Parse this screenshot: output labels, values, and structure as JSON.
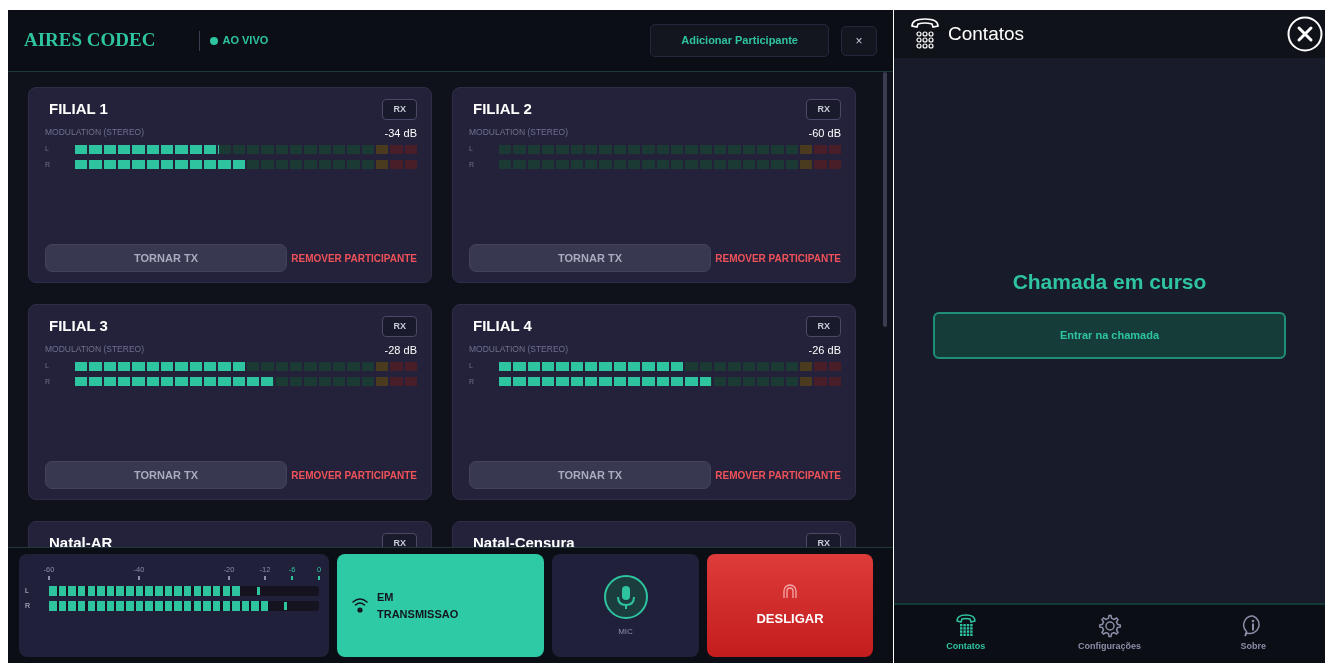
{
  "app": {
    "title": "AIRES CODEC",
    "status": {
      "label": "AO VIVO",
      "live": true
    },
    "add_button": "Adicionar Participante",
    "close_button": "×"
  },
  "participants": [
    {
      "name": "FILIAL 1",
      "badge": "RX",
      "meter_label": "MODULATION (STEREO)",
      "reading": "-34 dB",
      "channels": [
        {
          "label": "L",
          "level": 0.42
        },
        {
          "label": "R",
          "level": 0.5
        }
      ],
      "tx_button": "TORNAR TX",
      "remove_link": "REMOVER PARTICIPANTE"
    },
    {
      "name": "FILIAL 2",
      "badge": "RX",
      "meter_label": "MODULATION (STEREO)",
      "reading": "-60 dB",
      "channels": [
        {
          "label": "L",
          "level": 0
        },
        {
          "label": "R",
          "level": 0
        }
      ],
      "tx_button": "TORNAR TX",
      "remove_link": "REMOVER PARTICIPANTE"
    },
    {
      "name": "FILIAL 3",
      "badge": "RX",
      "meter_label": "MODULATION (STEREO)",
      "reading": "-28 dB",
      "channels": [
        {
          "label": "L",
          "level": 0.5
        },
        {
          "label": "R",
          "level": 0.58
        }
      ],
      "tx_button": "TORNAR TX",
      "remove_link": "REMOVER PARTICIPANTE"
    },
    {
      "name": "FILIAL 4",
      "badge": "RX",
      "meter_label": "MODULATION (STEREO)",
      "reading": "-26 dB",
      "channels": [
        {
          "label": "L",
          "level": 0.54
        },
        {
          "label": "R",
          "level": 0.62
        }
      ],
      "tx_button": "TORNAR TX",
      "remove_link": "REMOVER PARTICIPANTE"
    },
    {
      "name": "Natal-AR",
      "badge": "RX"
    },
    {
      "name": "Natal-Censura",
      "badge": "RX"
    }
  ],
  "master_meter": {
    "ticks": [
      {
        "label": "-60",
        "color": "#8a8fa8"
      },
      {
        "label": "-40",
        "color": "#8a8fa8"
      },
      {
        "label": "-20",
        "color": "#8a8fa8"
      },
      {
        "label": "-12",
        "color": "#8a8fa8"
      },
      {
        "label": "-6",
        "color": "#2ec4a0"
      },
      {
        "label": "0",
        "color": "#2ec4a0"
      }
    ],
    "channels": [
      {
        "label": "L",
        "level": 0.71
      },
      {
        "label": "R",
        "level": 0.81
      }
    ]
  },
  "transmit": {
    "label": "EM TRANSMISSAO",
    "on": true
  },
  "mic": {
    "label": "MIC",
    "on": true
  },
  "hangup": {
    "label": "DESLIGAR"
  },
  "contacts": {
    "title": "Contatos",
    "call_status": "Chamada em curso",
    "join_button": "Entrar na chamada",
    "nav": [
      {
        "label": "Contatos",
        "selected": true
      },
      {
        "label": "Configurações",
        "selected": false
      },
      {
        "label": "Sobre",
        "selected": false
      }
    ]
  }
}
